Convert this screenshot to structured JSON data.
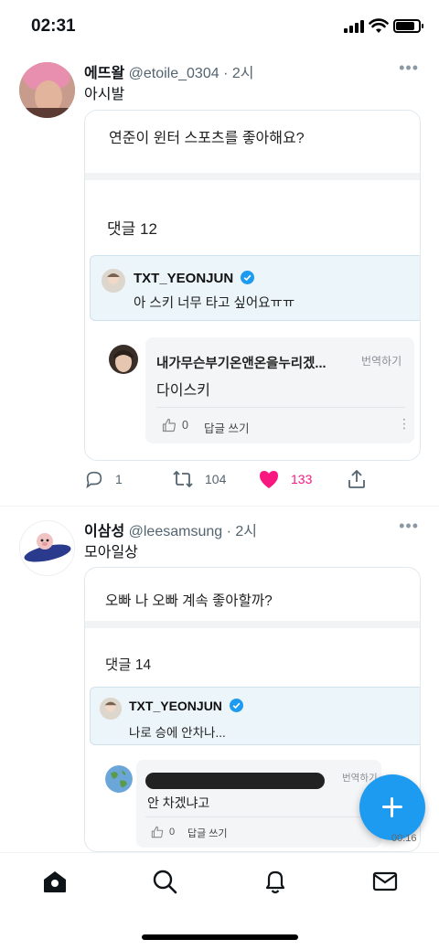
{
  "status": {
    "time": "02:31"
  },
  "tweets": [
    {
      "name": "에뜨왈",
      "handle": "@etoile_0304",
      "time": "· 2시",
      "text": "아시발",
      "card": {
        "question": "연준이 윈터 스포츠를 좋아해요?",
        "comment_count": "댓글 12",
        "pinned": {
          "name": "TXT_YEONJUN",
          "text": "아 스키 너무 타고 싶어요ㅠㅠ"
        },
        "reply": {
          "name": "내가무슨부기온앤온을누리겠...",
          "translate": "번역하기",
          "text": "다이스키",
          "likes": "0",
          "write_reply": "답글 쓰기"
        }
      },
      "actions": {
        "replies": "1",
        "retweets": "104",
        "likes": "133"
      }
    },
    {
      "name": "이삼성",
      "handle": "@leesamsung",
      "time": "· 2시",
      "text": "모아일상",
      "card": {
        "question": "오빠 나 오빠 계속 좋아할까?",
        "comment_count": "댓글 14",
        "pinned": {
          "name": "TXT_YEONJUN",
          "text": "나로 승에 안차나..."
        },
        "reply": {
          "translate": "번역하기",
          "text": "안 차겠냐고",
          "likes": "0",
          "write_reply": "답글 쓰기"
        }
      }
    }
  ],
  "video_time": "00:16",
  "icons": [
    "home-icon",
    "search-icon",
    "notifications-icon",
    "messages-icon",
    "compose-icon"
  ],
  "colors": {
    "accent": "#1d9bf0",
    "like": "#f91880",
    "verified": "#1d9bf0"
  }
}
